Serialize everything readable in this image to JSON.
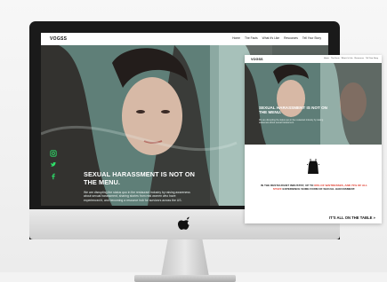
{
  "main_site": {
    "logo": "VOGSS",
    "nav_links": [
      "Home",
      "The Facts",
      "What it's Like",
      "Resources",
      "Tell Your Story"
    ],
    "headline": "SEXUAL HARASSMENT IS NOT ON THE MENU.",
    "body": "We are disrupting the status quo in the restaurant industry by raising awareness about sexual harassment, sharing stories from real women who have experienced it, and becoming a resource hub for survivors across the US.",
    "social_icons": [
      "instagram-icon",
      "twitter-icon",
      "facebook-icon"
    ]
  },
  "second_page": {
    "logo": "VOGSS",
    "nav_links": [
      "Home",
      "The Facts",
      "What it's Like",
      "Resources",
      "Tell Your Story"
    ],
    "headline": "SEXUAL HARASSMENT IS NOT ON THE MENU.",
    "body": "We are disrupting the status quo in the restaurant industry by raising awareness about sexual harassment.",
    "stat_line_1": "IN THE RESTAURANT INDUSTRY, UP TO",
    "stat_highlight": "80% OF WAITRESSES, AND 70% OF ALL STAFF",
    "stat_line_2": "EXPERIENCE SOME FORM OF SEXUAL HARASSMENT.",
    "tagline": "IT'S ALL ON THE TABLE »"
  },
  "colors": {
    "accent_red": "#e0392b",
    "hero_teal": "#6f8e86"
  }
}
